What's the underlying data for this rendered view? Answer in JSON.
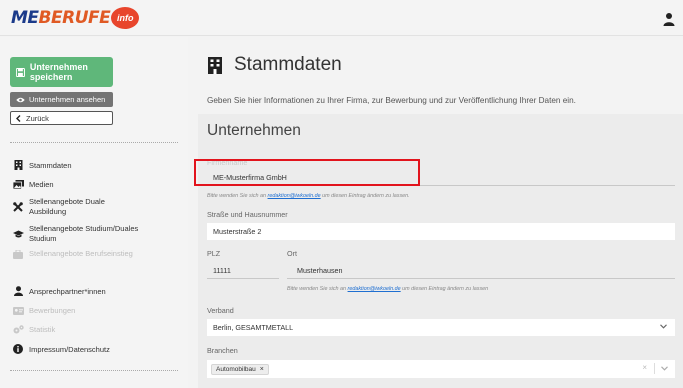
{
  "brand": {
    "logo_me": "ME",
    "logo_berufe": "BERUFE",
    "logo_badge": "info"
  },
  "sidebar": {
    "save_label": "Unternehmen speichern",
    "view_label": "Unternehmen ansehen",
    "back_label": "Zurück",
    "items": [
      {
        "label": "Stammdaten",
        "icon": "building-icon",
        "enabled": true
      },
      {
        "label": "Medien",
        "icon": "images-icon",
        "enabled": true
      },
      {
        "label": "Stellenangebote Duale Ausbildung",
        "icon": "tools-icon",
        "enabled": true
      },
      {
        "label": "Stellenangebote Studium/Duales Studium",
        "icon": "graduation-cap-icon",
        "enabled": true
      },
      {
        "label": "Stellenangebote Berufseinstieg",
        "icon": "briefcase-icon",
        "enabled": false
      },
      {
        "label": "Ansprechpartner*innen",
        "icon": "person-icon",
        "enabled": true
      },
      {
        "label": "Bewerbungen",
        "icon": "id-card-icon",
        "enabled": false
      },
      {
        "label": "Statistik",
        "icon": "cogs-icon",
        "enabled": false
      },
      {
        "label": "Impressum/Datenschutz",
        "icon": "info-circle-icon",
        "enabled": true
      }
    ]
  },
  "page": {
    "title": "Stammdaten",
    "intro": "Geben Sie hier Informationen zu Ihrer Firma, zur Bewerbung und zur Veröffentlichung Ihrer Daten ein."
  },
  "form": {
    "section_title": "Unternehmen",
    "company_label": "Firmenname",
    "company_value": "ME-Musterfirma GmbH",
    "company_hint_pre": "Bitte wenden Sie sich an",
    "company_hint_link": "redaktion@iwkoeln.de",
    "company_hint_post": "um diesen Eintrag ändern zu lassen.",
    "street_label": "Straße und Hausnummer",
    "street_value": "Musterstraße 2",
    "zip_label": "PLZ",
    "zip_value": "11111",
    "city_label": "Ort",
    "city_value": "Musterhausen",
    "city_hint_pre": "Bitte wenden Sie sich an",
    "city_hint_link": "redaktion@iwkoeln.de",
    "city_hint_post": "um diesen Eintrag ändern zu lassen",
    "verband_label": "Verband",
    "verband_value": "Berlin, GESAMTMETALL",
    "branchen_label": "Branchen",
    "branchen_chip": "Automobilbau",
    "chip_remove": "×",
    "clear_symbol": "×"
  },
  "colors": {
    "save_green": "#5fb77a",
    "highlight_red": "#e2141d",
    "link_blue": "#1f6fd1"
  }
}
